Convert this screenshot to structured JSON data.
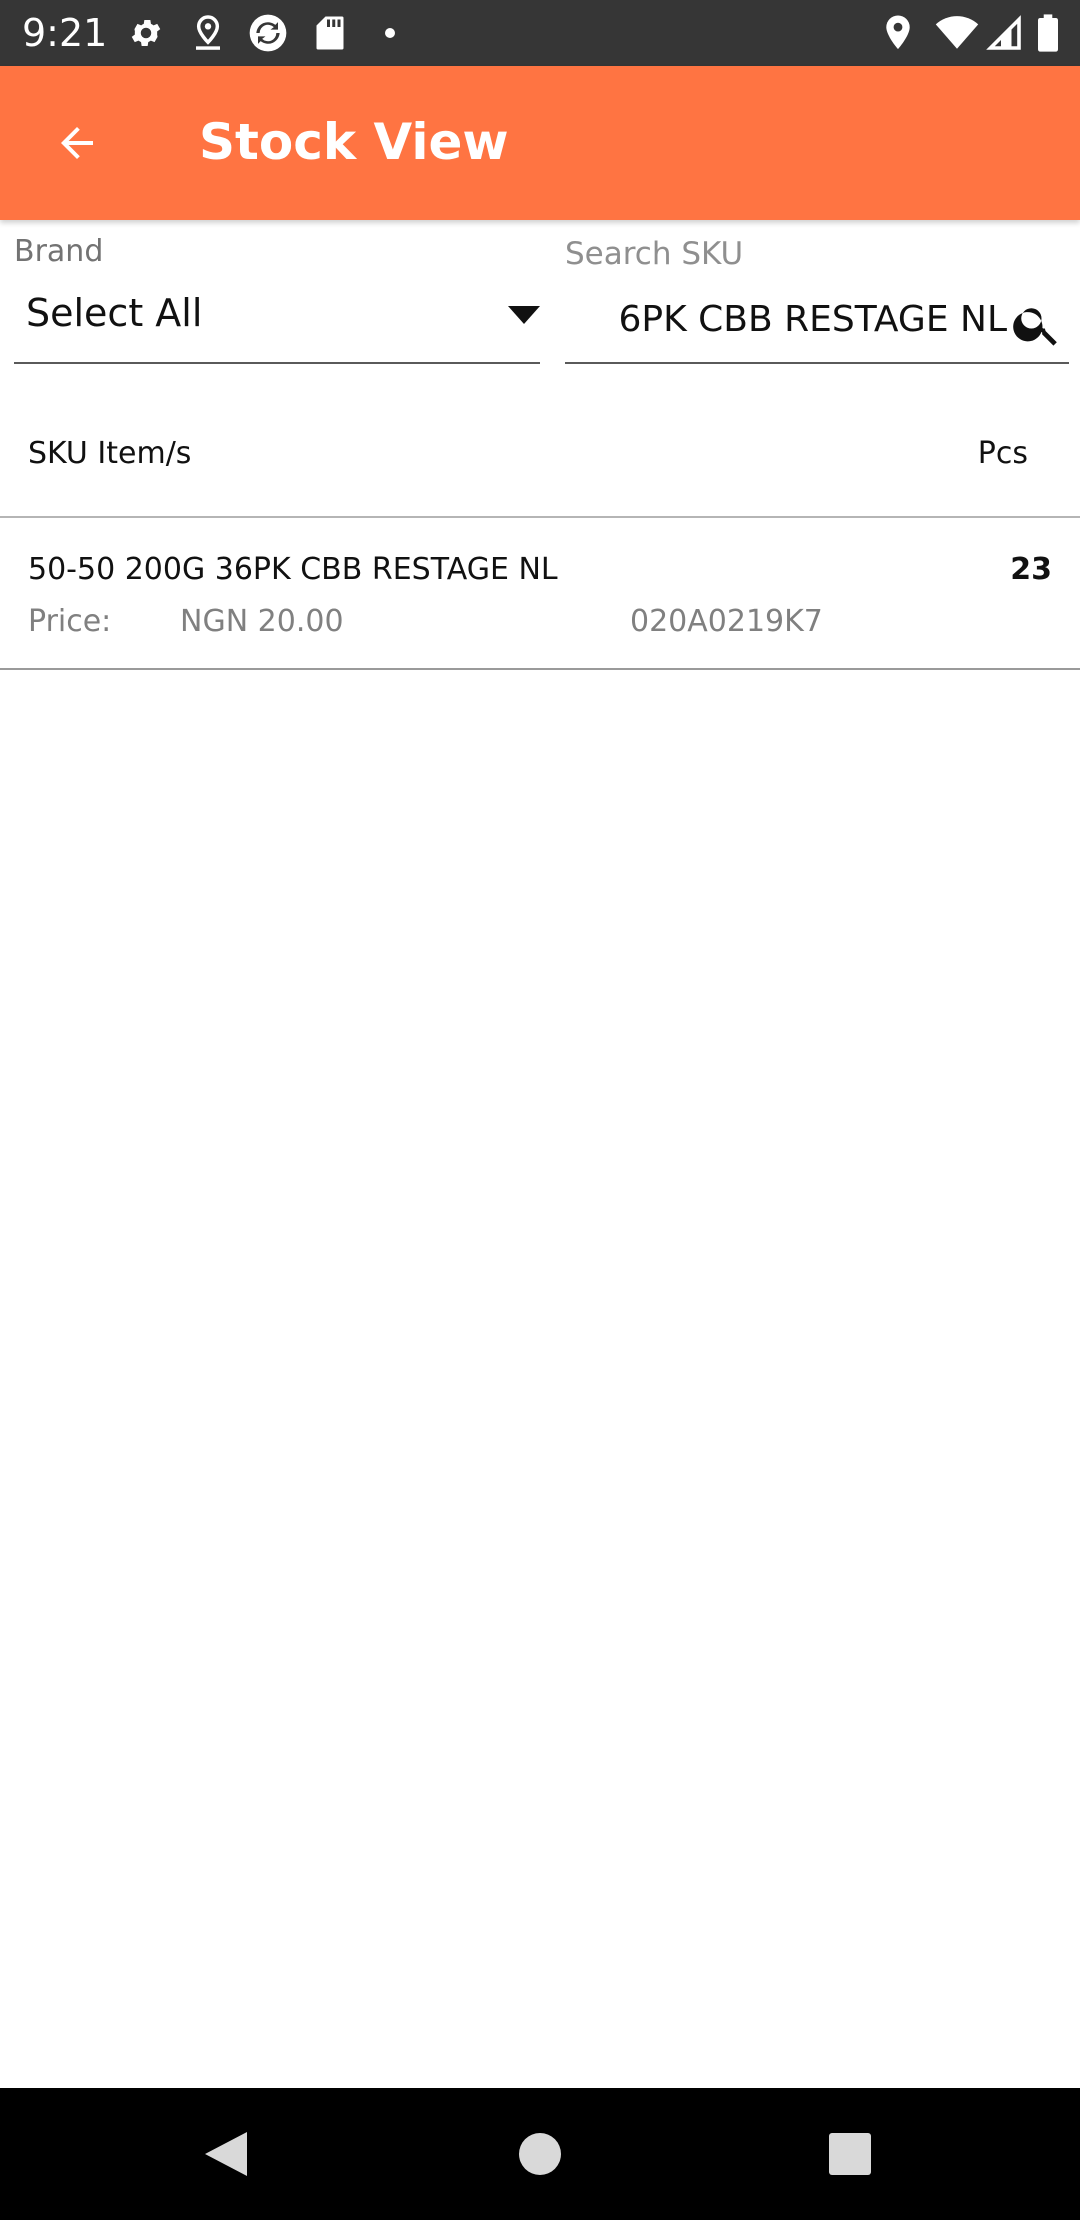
{
  "status_bar": {
    "time": "9:21",
    "left_icons": [
      "gear-icon",
      "location-pin-icon",
      "sync-icon",
      "sd-card-icon",
      "dot-icon"
    ],
    "right_icons": [
      "location-icon",
      "wifi-icon",
      "signal-icon",
      "battery-icon"
    ]
  },
  "app_bar": {
    "title": "Stock View",
    "back_icon": "arrow-left-icon",
    "color": "#FF7442"
  },
  "filters": {
    "brand_label": "Brand",
    "brand_value": "Select All",
    "search_label": "Search SKU",
    "search_value": "6PK CBB RESTAGE NL"
  },
  "list": {
    "headers": {
      "sku": "SKU Item/s",
      "pcs": "Pcs"
    },
    "rows": [
      {
        "name": "50-50 200G 36PK CBB RESTAGE NL",
        "qty": "23",
        "price_label": "Price:",
        "price": "NGN 20.00",
        "code": "020A0219K7"
      }
    ]
  },
  "nav_bar": {
    "icons": [
      "back-triangle-icon",
      "home-circle-icon",
      "recents-square-icon"
    ]
  }
}
